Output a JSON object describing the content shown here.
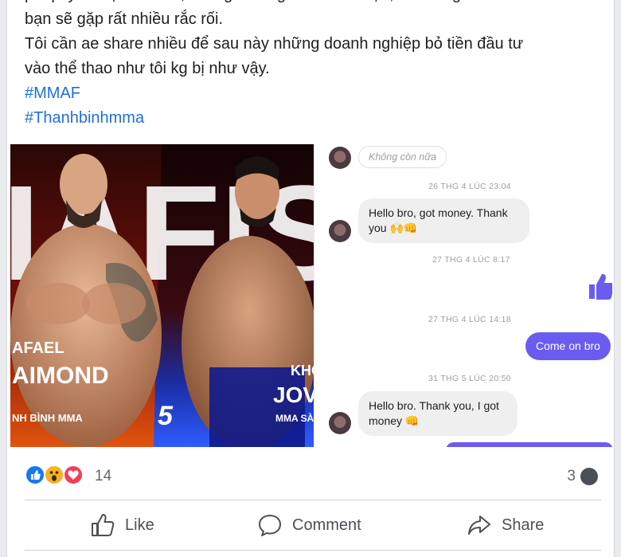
{
  "post": {
    "cut_line": "pháp lý về sự cam kết, không nên nghe lời hứa hẹn, vì những thứ đó có thể khiến",
    "lines": [
      "bạn sẽ gặp rất nhiều rắc rối.",
      "Tôi cần ae share nhiều để sau này những doanh nghiệp bỏ tiền đầu tư",
      "vào thể thao như tôi kg bị như vậy."
    ],
    "hashtags": [
      "#MMAF",
      "#Thanhbinhmma"
    ]
  },
  "photo": {
    "left_fighter_line1": "AFAEL",
    "left_fighter_line2": "AIMOND",
    "left_team": "NH BÌNH MMA",
    "right_fighter_line1": "KHO",
    "right_fighter_line2": "JOVID",
    "right_team": "MMA SÀ",
    "bg_letters": "IAFIS",
    "event_number": "5"
  },
  "chat": {
    "ghost_pill": "Không còn nữa",
    "ts1": "26 THG 4 LÚC 23:04",
    "msg1": "Hello bro, got money. Thank you 🙌👊",
    "ts2": "27 THG 4 LÚC 8:17",
    "ts3": "27 THG 4 LÚC 14:18",
    "msg_out": "Come on bro",
    "ts4": "31 THG 5 LÚC 20:50",
    "msg2": "Hello bro. Thank you, I got money 👊",
    "colors": {
      "outgoing": "#6b5cf0",
      "incoming": "#efefef"
    }
  },
  "stats": {
    "reaction_count": "14",
    "comment_count": "3"
  },
  "actions": {
    "like": "Like",
    "comment": "Comment",
    "share": "Share"
  },
  "colors": {
    "hashtag": "#216fdb",
    "like_blue": "#1877f2",
    "love_red": "#f33e58",
    "wow_yellow": "#f7b125"
  }
}
